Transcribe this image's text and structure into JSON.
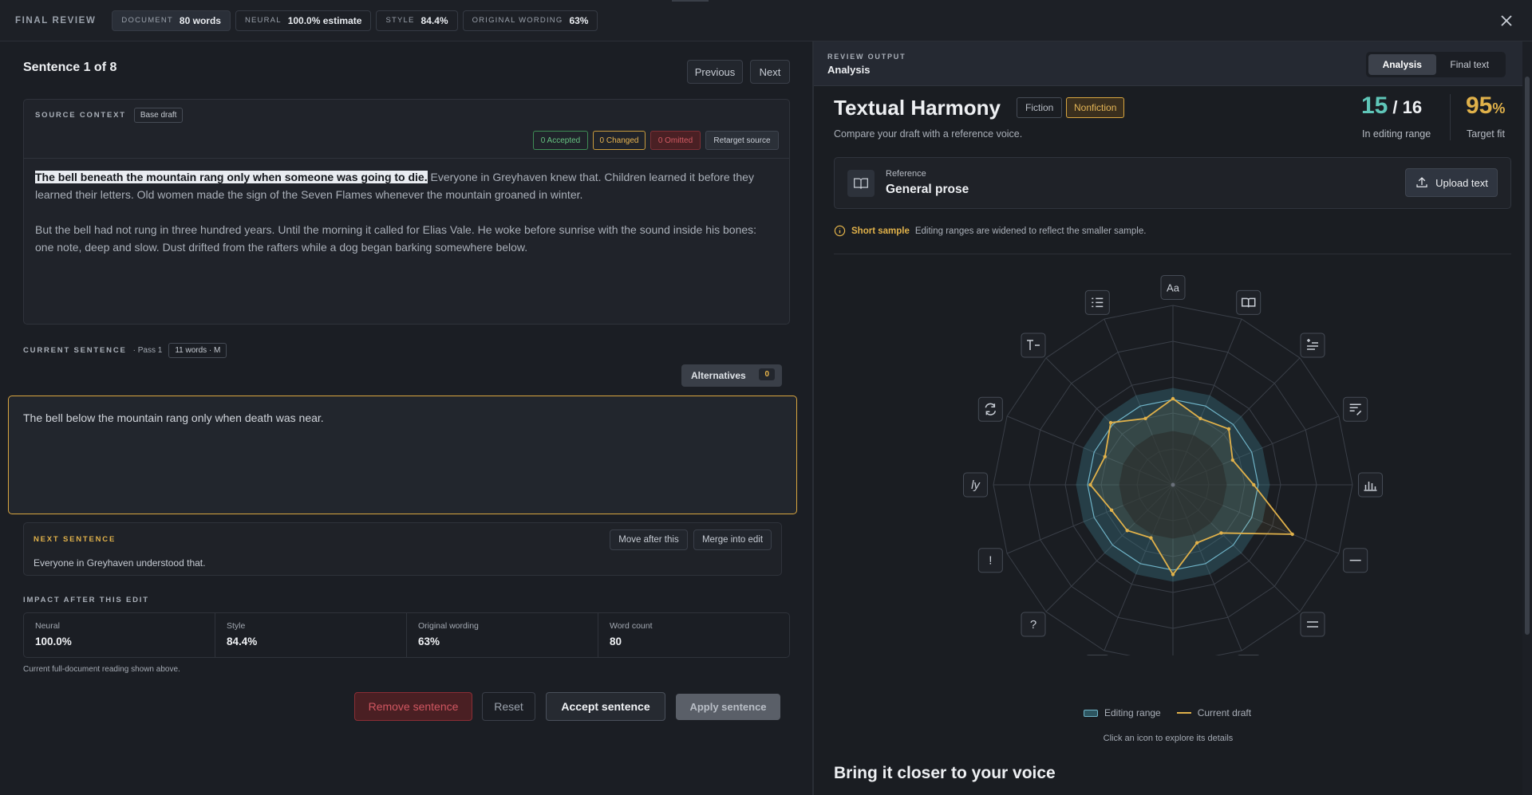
{
  "topbar": {
    "title": "FINAL REVIEW",
    "pills": [
      {
        "label": "DOCUMENT",
        "value": "80 words"
      },
      {
        "label": "NEURAL",
        "value": "100.0% estimate"
      },
      {
        "label": "STYLE",
        "value": "84.4%"
      },
      {
        "label": "ORIGINAL WORDING",
        "value": "63%"
      }
    ]
  },
  "left": {
    "sentence_title": "Sentence 1 of 8",
    "previous": "Previous",
    "next": "Next",
    "source": {
      "caption": "SOURCE CONTEXT",
      "tag": "Base draft",
      "chips": {
        "accepted": "0 Accepted",
        "changed": "0 Changed",
        "omitted": "0 Omitted"
      },
      "retarget": "Retarget source",
      "highlight": "The bell beneath the mountain rang only when someone was going to die.",
      "p1_rest": " Everyone in Greyhaven knew that. Children learned it before they learned their letters. Old women made the sign of the Seven Flames whenever the mountain groaned in winter.",
      "p2": "But the bell had not rung in three hundred years. Until the morning it called for Elias Vale. He woke before sunrise with the sound inside his bones: one note, deep and slow. Dust drifted from the rafters while a dog began barking somewhere below."
    },
    "current": {
      "caption": "CURRENT SENTENCE",
      "pass": "· Pass 1",
      "words": "11 words · M",
      "alternatives": "Alternatives",
      "alt_count": "0",
      "text": "The bell below the mountain rang only when death was near."
    },
    "next_sentence": {
      "caption": "NEXT SENTENCE",
      "text": "Everyone in Greyhaven understood that.",
      "move": "Move after this",
      "merge": "Merge into edit"
    },
    "impact": {
      "caption": "IMPACT AFTER THIS EDIT",
      "cells": [
        {
          "k": "Neural",
          "v": "100.0%"
        },
        {
          "k": "Style",
          "v": "84.4%"
        },
        {
          "k": "Original wording",
          "v": "63%"
        },
        {
          "k": "Word count",
          "v": "80"
        }
      ],
      "note": "Current full-document reading shown above."
    },
    "actions": {
      "remove": "Remove sentence",
      "reset": "Reset",
      "accept": "Accept sentence",
      "apply": "Apply sentence"
    }
  },
  "right": {
    "header_caption": "REVIEW OUTPUT",
    "header_title": "Analysis",
    "tabs": [
      "Analysis",
      "Final text"
    ],
    "heading": "Textual Harmony",
    "genre_fiction": "Fiction",
    "genre_nonfiction": "Nonfiction",
    "subtitle": "Compare your draft with a reference voice.",
    "range_value": "15",
    "range_total": "/ 16",
    "range_label": "In editing range",
    "fit_value": "95",
    "fit_unit": "%",
    "fit_label": "Target fit",
    "reference_label": "Reference",
    "reference_value": "General prose",
    "upload": "Upload text",
    "notice_label": "Short sample",
    "notice_text": "Editing ranges are widened to reflect the smaller sample.",
    "axis_glyphs": [
      "Aa",
      ",",
      "ly",
      "!",
      "?",
      ";"
    ],
    "legend_range": "Editing range",
    "legend_draft": "Current draft",
    "hint": "Click an icon to explore its details",
    "bottom_heading": "Bring it closer to your voice"
  },
  "radar": {
    "axes": 16,
    "range_outer": [
      0.54,
      0.54,
      0.54,
      0.54,
      0.54,
      0.54,
      0.54,
      0.54,
      0.54,
      0.54,
      0.54,
      0.54,
      0.54,
      0.54,
      0.54,
      0.54
    ],
    "range_inner": [
      0.3,
      0.3,
      0.3,
      0.3,
      0.3,
      0.3,
      0.3,
      0.3,
      0.3,
      0.3,
      0.3,
      0.3,
      0.3,
      0.3,
      0.3,
      0.3
    ],
    "draft": [
      0.48,
      0.4,
      0.44,
      0.36,
      0.45,
      0.72,
      0.38,
      0.35,
      0.5,
      0.32,
      0.36,
      0.37,
      0.46,
      0.41,
      0.49,
      0.4
    ],
    "colors": {
      "range": "#3f7f8c",
      "draft": "#e0b14a",
      "grid": "#3a3f48"
    }
  }
}
